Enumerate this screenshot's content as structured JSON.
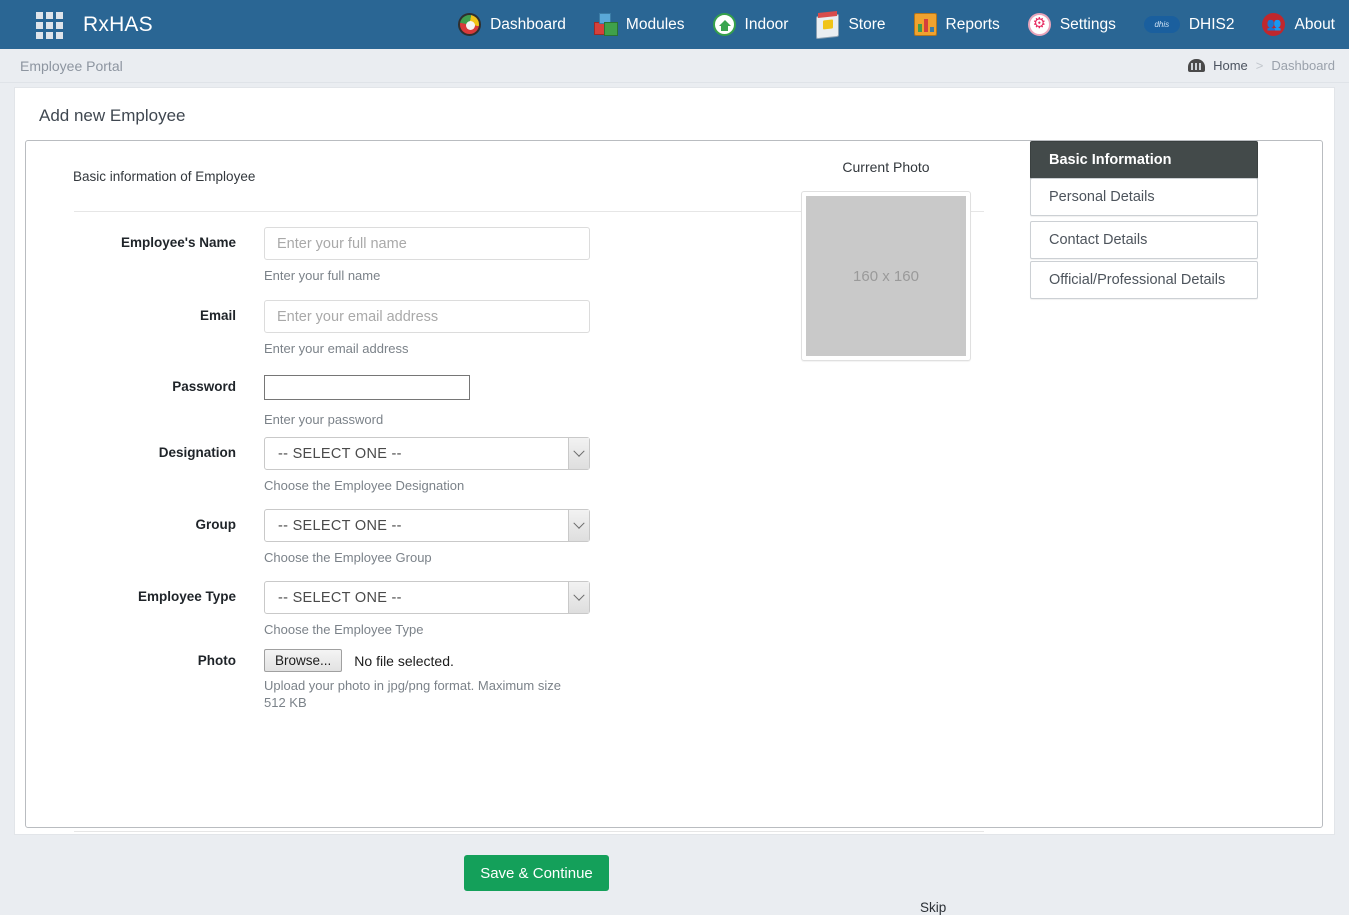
{
  "navbar": {
    "apps_icon": "apps-grid-icon",
    "brand": "RxHAS",
    "items": [
      {
        "label": "Dashboard",
        "icon": "dashboard-icon"
      },
      {
        "label": "Modules",
        "icon": "modules-icon"
      },
      {
        "label": "Indoor",
        "icon": "indoor-home-icon"
      },
      {
        "label": "Store",
        "icon": "store-icon"
      },
      {
        "label": "Reports",
        "icon": "reports-icon"
      },
      {
        "label": "Settings",
        "icon": "settings-gear-icon"
      },
      {
        "label": "DHIS2",
        "icon": "dhis2-logo-icon"
      },
      {
        "label": "About",
        "icon": "about-people-icon"
      }
    ],
    "background_color": "#2a6694"
  },
  "breadcrumb": {
    "portal_label": "Employee Portal",
    "home": "Home",
    "separator": ">",
    "current": "Dashboard"
  },
  "page": {
    "title": "Add new Employee",
    "panel_heading": "Basic information of Employee"
  },
  "form": {
    "fields": [
      {
        "label": "Employee's Name",
        "type": "text",
        "value": "",
        "placeholder": "Enter your full name",
        "help": "Enter your full name"
      },
      {
        "label": "Email",
        "type": "text",
        "value": "",
        "placeholder": "Enter your email address",
        "help": "Enter your email address"
      },
      {
        "label": "Password",
        "type": "password",
        "value": "",
        "placeholder": "",
        "help": "Enter your password"
      },
      {
        "label": "Designation",
        "type": "select",
        "value": "-- SELECT ONE --",
        "help": "Choose the Employee Designation"
      },
      {
        "label": "Group",
        "type": "select",
        "value": "-- SELECT ONE --",
        "help": "Choose the Employee Group"
      },
      {
        "label": "Employee Type",
        "type": "select",
        "value": "-- SELECT ONE --",
        "help": "Choose the Employee Type"
      },
      {
        "label": "Photo",
        "type": "file",
        "browse_label": "Browse...",
        "file_status": "No file selected.",
        "help": "Upload your photo in jpg/png format. Maximum size 512 KB"
      }
    ]
  },
  "photo": {
    "caption": "Current Photo",
    "placeholder_text": "160 x 160"
  },
  "steps": [
    {
      "label": "Basic Information",
      "active": true
    },
    {
      "label": "Personal Details",
      "active": false
    },
    {
      "label": "Contact Details",
      "active": false
    },
    {
      "label": "Official/Professional Details",
      "active": false
    }
  ],
  "actions": {
    "save_label": "Save & Continue",
    "save_color": "#14a05a",
    "skip_label": "Skip"
  }
}
